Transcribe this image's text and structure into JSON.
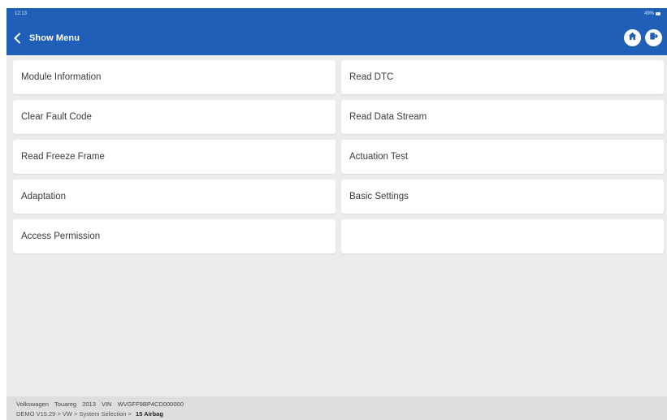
{
  "status_bar": {
    "time": "12:13",
    "battery": "49%"
  },
  "header": {
    "title": "Show Menu",
    "back_icon": "chevron-left-icon",
    "home_icon": "home-icon",
    "exit_icon": "exit-icon"
  },
  "menu": {
    "items": [
      {
        "label": "Module Information"
      },
      {
        "label": "Read DTC"
      },
      {
        "label": "Clear Fault Code"
      },
      {
        "label": "Read Data Stream"
      },
      {
        "label": "Read Freeze Frame"
      },
      {
        "label": "Actuation Test"
      },
      {
        "label": "Adaptation"
      },
      {
        "label": "Basic Settings"
      },
      {
        "label": "Access Permission"
      }
    ]
  },
  "footer": {
    "make": "Volkswagen",
    "model": "Touareg",
    "year": "2013",
    "vin_label": "VIN",
    "vin": "WVGFF9BP4CD000000",
    "path": "DEMO V15.29 > VW > System Selection >",
    "current_system": "15 Airbag"
  },
  "colors": {
    "header_bg": "#1f5fb8",
    "screen_bg": "#ececec",
    "footer_bg": "#dedede"
  }
}
